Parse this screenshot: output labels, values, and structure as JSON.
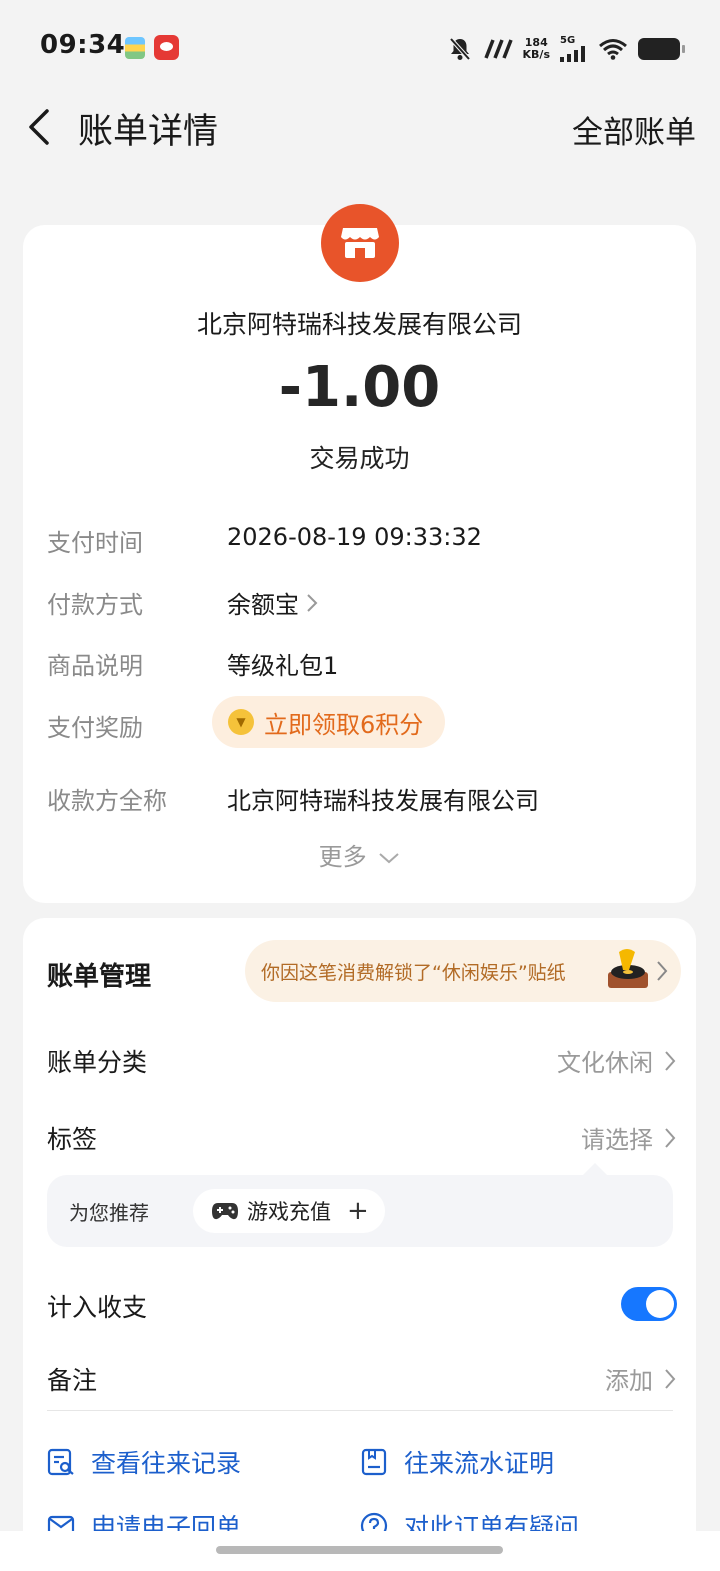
{
  "status_bar": {
    "time": "09:34",
    "net_speed_value": "184",
    "net_speed_unit": "KB/s",
    "network_type": "5G"
  },
  "header": {
    "title": "账单详情",
    "all_bills": "全部账单"
  },
  "summary": {
    "merchant": "北京阿特瑞科技发展有限公司",
    "amount": "-1.00",
    "status": "交易成功",
    "icon_color": "#e8542a"
  },
  "details": {
    "pay_time_label": "支付时间",
    "pay_time_value": "2026-08-19 09:33:32",
    "pay_method_label": "付款方式",
    "pay_method_value": "余额宝",
    "product_label": "商品说明",
    "product_value": "等级礼包1",
    "reward_label": "支付奖励",
    "reward_value": "立即领取6积分",
    "payee_label": "收款方全称",
    "payee_value": "北京阿特瑞科技发展有限公司",
    "more": "更多"
  },
  "management": {
    "title": "账单管理",
    "unlock_text": "你因这笔消费解锁了“休闲娱乐”贴纸",
    "category_label": "账单分类",
    "category_value": "文化休闲",
    "tag_label": "标签",
    "tag_value": "请选择",
    "recommend_label": "为您推荐",
    "recommend_tag": "游戏充值",
    "include_label": "计入收支",
    "include_on": true,
    "note_label": "备注",
    "note_value": "添加"
  },
  "links": {
    "history": "查看往来记录",
    "flow_proof": "往来流水证明",
    "e_receipt": "申请电子回单",
    "question": "对此订单有疑问"
  },
  "colors": {
    "accent_blue": "#1677ff",
    "link_blue": "#1c5fcc",
    "reward_orange": "#e26a1c"
  }
}
